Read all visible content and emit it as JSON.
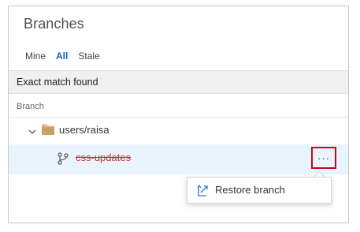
{
  "header": {
    "title": "Branches"
  },
  "tabs": [
    {
      "label": "Mine"
    },
    {
      "label": "All"
    },
    {
      "label": "Stale"
    }
  ],
  "banner": {
    "text": "Exact match found"
  },
  "table": {
    "column_header": "Branch",
    "folder": {
      "name": "users/raisa"
    },
    "branch": {
      "name": "css-updates"
    },
    "more_label": "···"
  },
  "context_menu": {
    "items": [
      {
        "label": "Restore branch"
      }
    ]
  },
  "colors": {
    "accent": "#0b64c7",
    "deleted_branch": "#c3323b",
    "highlight_border": "#d0021b",
    "row_selected": "#eaf4fd"
  },
  "icons": [
    "chevron-down-icon",
    "folder-icon",
    "branch-icon",
    "more-icon",
    "restore-icon"
  ]
}
